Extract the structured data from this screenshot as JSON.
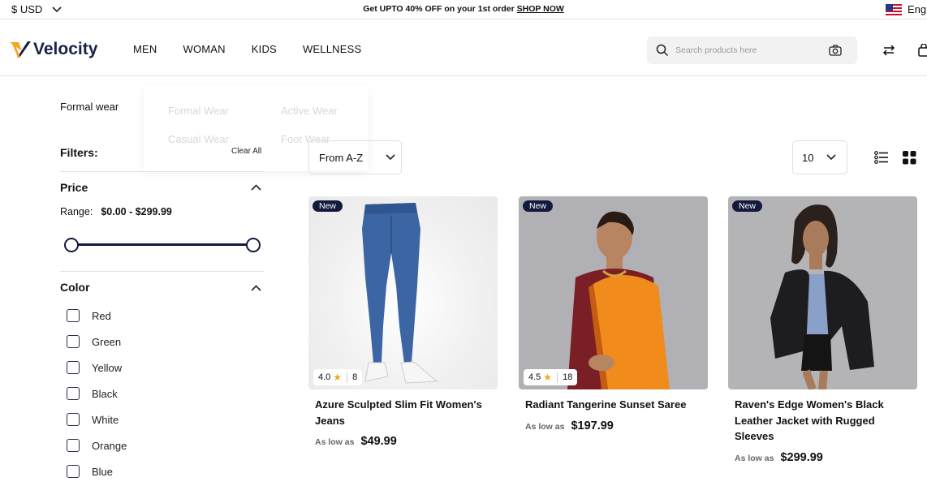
{
  "topbar": {
    "currency": "$ USD",
    "promo_text": "Get UPTO 40% OFF on your 1st order",
    "promo_link": "SHOP NOW",
    "language": "Eng"
  },
  "header": {
    "logo": "Velocity",
    "nav": [
      "MEN",
      "WOMAN",
      "KIDS",
      "WELLNESS"
    ],
    "search_placeholder": "Search products here"
  },
  "dropdown": {
    "items": [
      "Formal Wear",
      "Active Wear",
      "Casual Wear",
      "Foot Wear"
    ],
    "clear_all": "Clear All"
  },
  "sidebar": {
    "breadcrumb": "Formal wear",
    "filters_label": "Filters:",
    "price": {
      "title": "Price",
      "range_label": "Range:",
      "range_value": "$0.00 - $299.99"
    },
    "color": {
      "title": "Color",
      "options": [
        "Red",
        "Green",
        "Yellow",
        "Black",
        "White",
        "Orange",
        "Blue"
      ]
    }
  },
  "toolbar": {
    "sort": "From A-Z",
    "per_page": "10"
  },
  "products": [
    {
      "badge": "New",
      "rating": "4.0",
      "reviews": "8",
      "title": "Azure Sculpted Slim Fit Women's Jeans",
      "price_label": "As low as",
      "price": "$49.99"
    },
    {
      "badge": "New",
      "rating": "4.5",
      "reviews": "18",
      "title": "Radiant Tangerine Sunset Saree",
      "price_label": "As low as",
      "price": "$197.99"
    },
    {
      "badge": "New",
      "title": "Raven's Edge Women's Black Leather Jacket with Rugged Sleeves",
      "price_label": "As low as",
      "price": "$299.99"
    }
  ],
  "colors": {
    "brand_navy": "#141a3c",
    "logo_gold": "#f5a623",
    "search_bg": "#f2f2f2"
  }
}
